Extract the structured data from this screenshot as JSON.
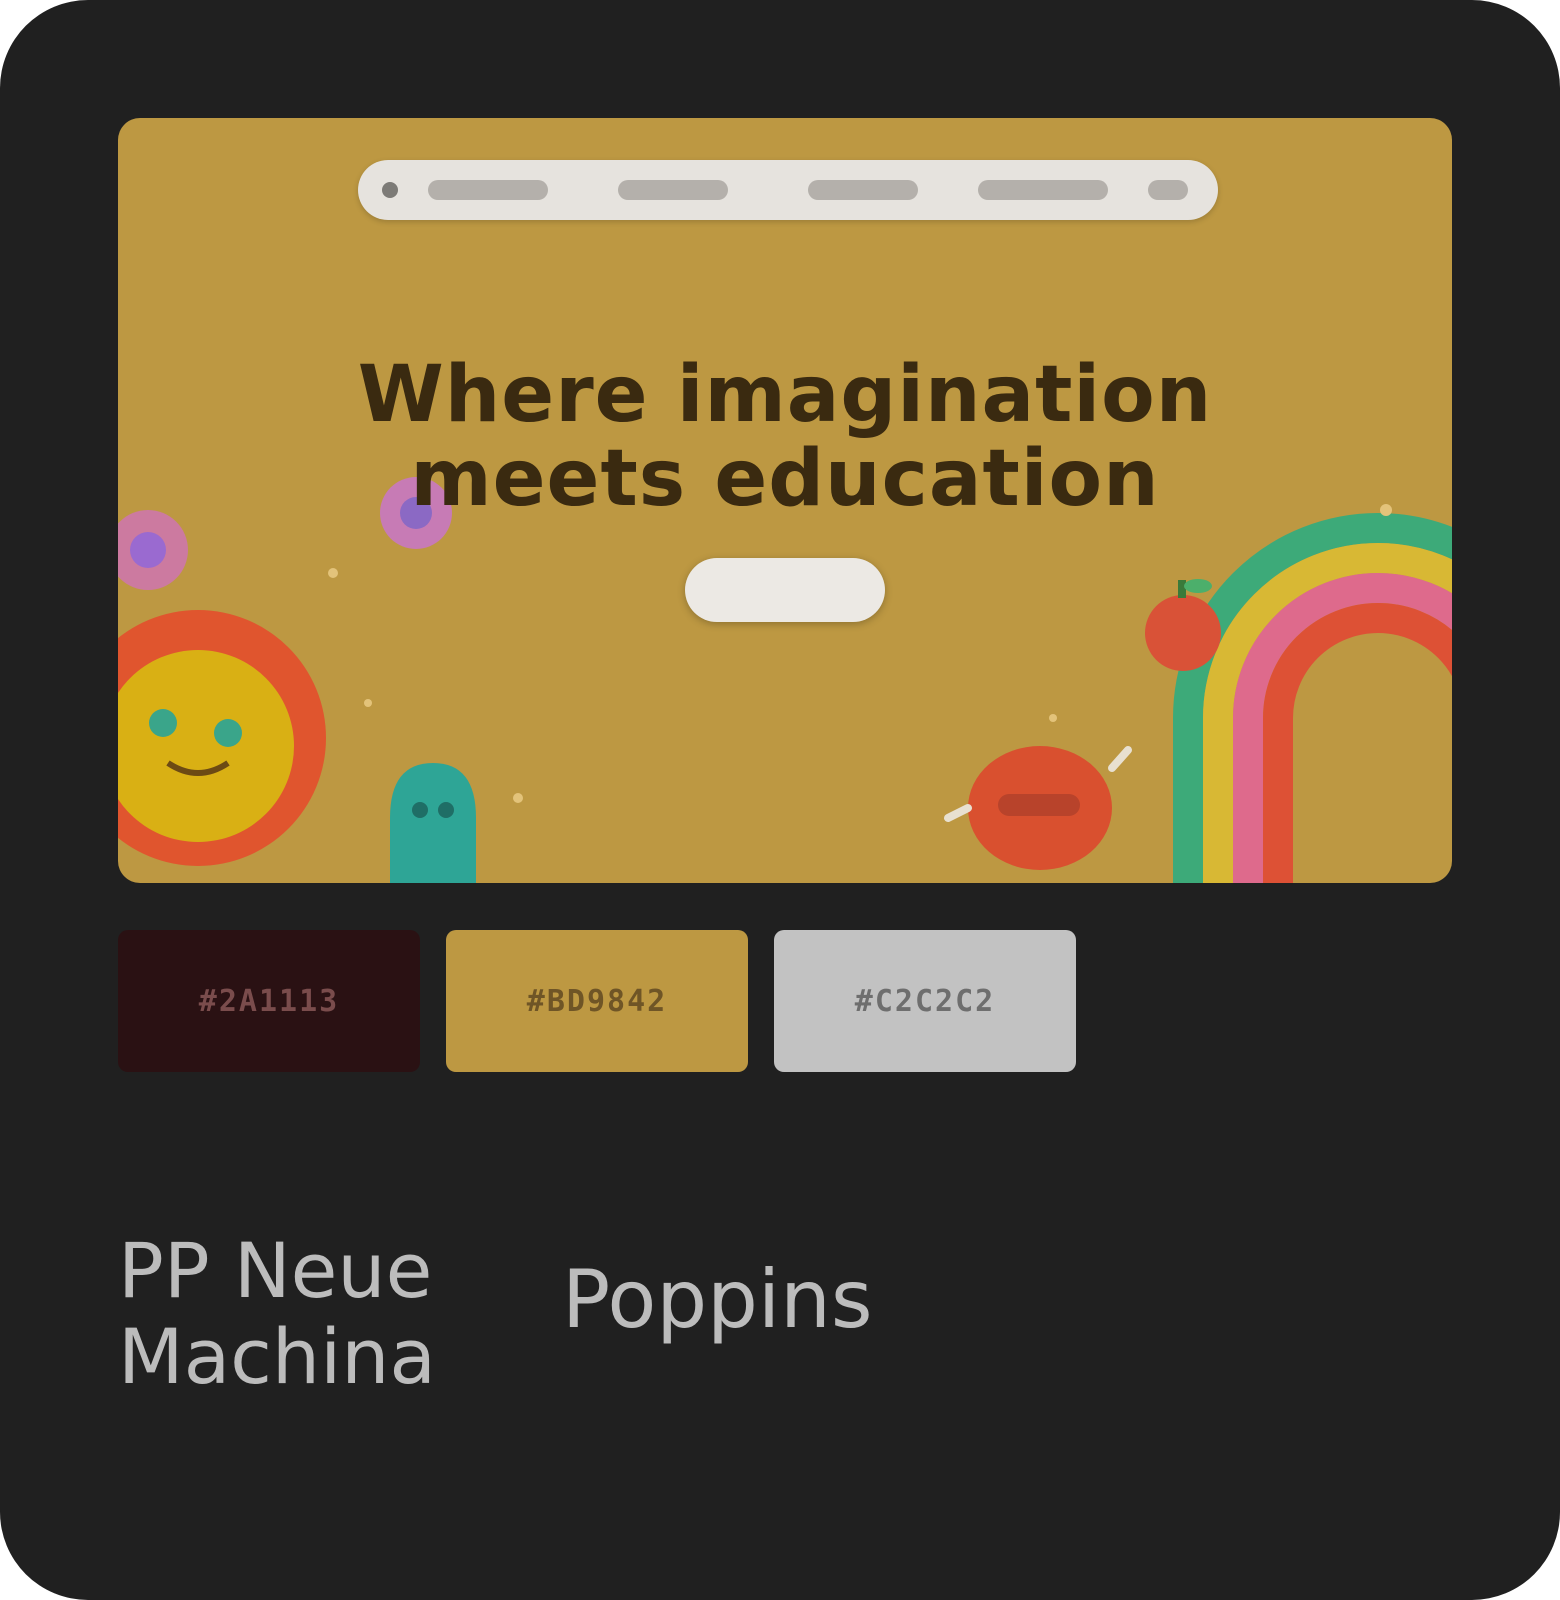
{
  "hero": {
    "heading_line1": "Where imagination",
    "heading_line2": "meets education",
    "cta_label": ""
  },
  "palette": [
    {
      "hex": "#2A1113",
      "name": ""
    },
    {
      "hex": "#BD9842",
      "name": ""
    },
    {
      "hex": "#C2C2C2",
      "name": ""
    }
  ],
  "fonts": [
    {
      "name_line1": "PP Neue",
      "name_line2": "Machina",
      "meta": ""
    },
    {
      "name_line1": "Poppins",
      "meta": ""
    }
  ],
  "colors": {
    "card_background": "#202020",
    "hero_background": "#BD9842",
    "heading_text": "#3A2A10"
  }
}
